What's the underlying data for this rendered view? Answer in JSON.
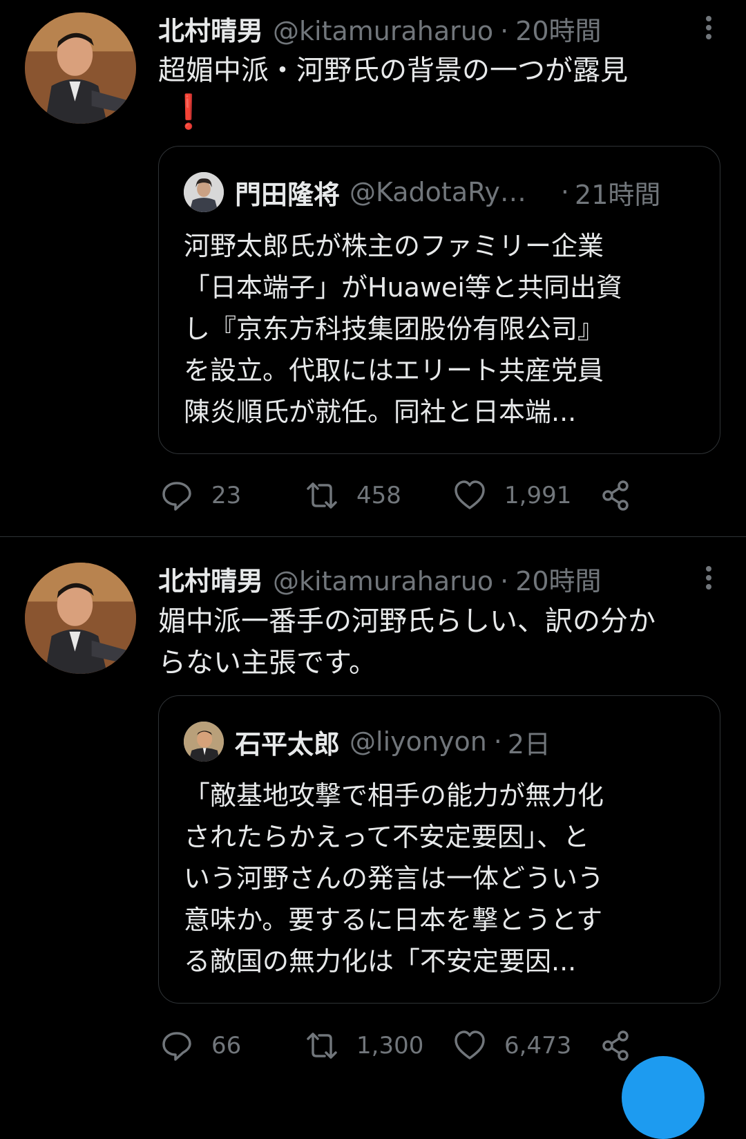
{
  "tweets": [
    {
      "author_name": "北村晴男",
      "author_handle": "@kitamuraharuo",
      "separator": "·",
      "time": "20時間",
      "text_lines": [
        "超媚中派・河野氏の背景の一つが露見"
      ],
      "emoji": "❗",
      "quote": {
        "author_name": "門田隆将",
        "author_handle": "@KadotaRy…",
        "separator": "·",
        "time": "21時間",
        "text_lines": [
          "河野太郎氏が株主のファミリー企業",
          "「日本端子」がHuawei等と共同出資",
          "し『京东方科技集团股份有限公司』",
          "を設立。代取にはエリート共産党員",
          "陳炎順氏が就任。同社と日本端..."
        ]
      },
      "stats": {
        "replies": "23",
        "retweets": "458",
        "likes": "1,991"
      }
    },
    {
      "author_name": "北村晴男",
      "author_handle": "@kitamuraharuo",
      "separator": "·",
      "time": "20時間",
      "text_lines": [
        "媚中派一番手の河野氏らしい、訳の分か",
        "らない主張です。"
      ],
      "quote": {
        "author_name": "石平太郎",
        "author_handle": "@liyonyon",
        "separator": "·",
        "time": "2日",
        "text_lines": [
          "「敵基地攻撃で相手の能力が無力化",
          "されたらかえって不安定要因」、と",
          "いう河野さんの発言は一体どういう",
          "意味か。要するに日本を撃とうとす",
          "る敵国の無力化は「不安定要因..."
        ]
      },
      "stats": {
        "replies": "66",
        "retweets": "1,300",
        "likes": "6,473"
      }
    }
  ],
  "icons": {
    "reply": "reply-icon",
    "retweet": "retweet-icon",
    "like": "heart-icon",
    "share": "share-icon",
    "more": "more-options-icon"
  },
  "colors": {
    "background": "#000000",
    "text": "#e7e9ea",
    "muted": "#71767b",
    "border": "#2f3336",
    "accent": "#1d9bf0",
    "emoji_red": "#e0245e"
  }
}
